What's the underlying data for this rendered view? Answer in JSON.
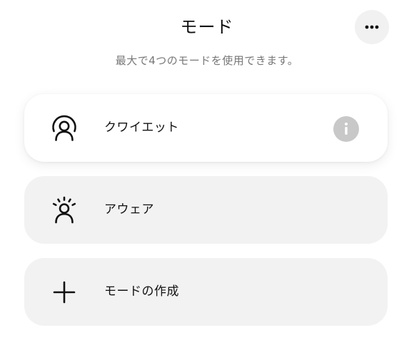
{
  "header": {
    "title": "モード",
    "more_icon": "more-horizontal-icon"
  },
  "subtitle": "最大で4つのモードを使用できます。",
  "modes": [
    {
      "label": "クワイエット",
      "icon": "quiet-person-icon",
      "active": true,
      "info_icon": "info-icon"
    },
    {
      "label": "アウェア",
      "icon": "aware-person-icon",
      "active": false
    },
    {
      "label": "モードの作成",
      "icon": "plus-icon",
      "active": false
    }
  ],
  "colors": {
    "active_card": "#ffffff",
    "inactive_card": "#f2f2f2",
    "subtitle": "#777777",
    "info_button": "#c8c8c8"
  }
}
